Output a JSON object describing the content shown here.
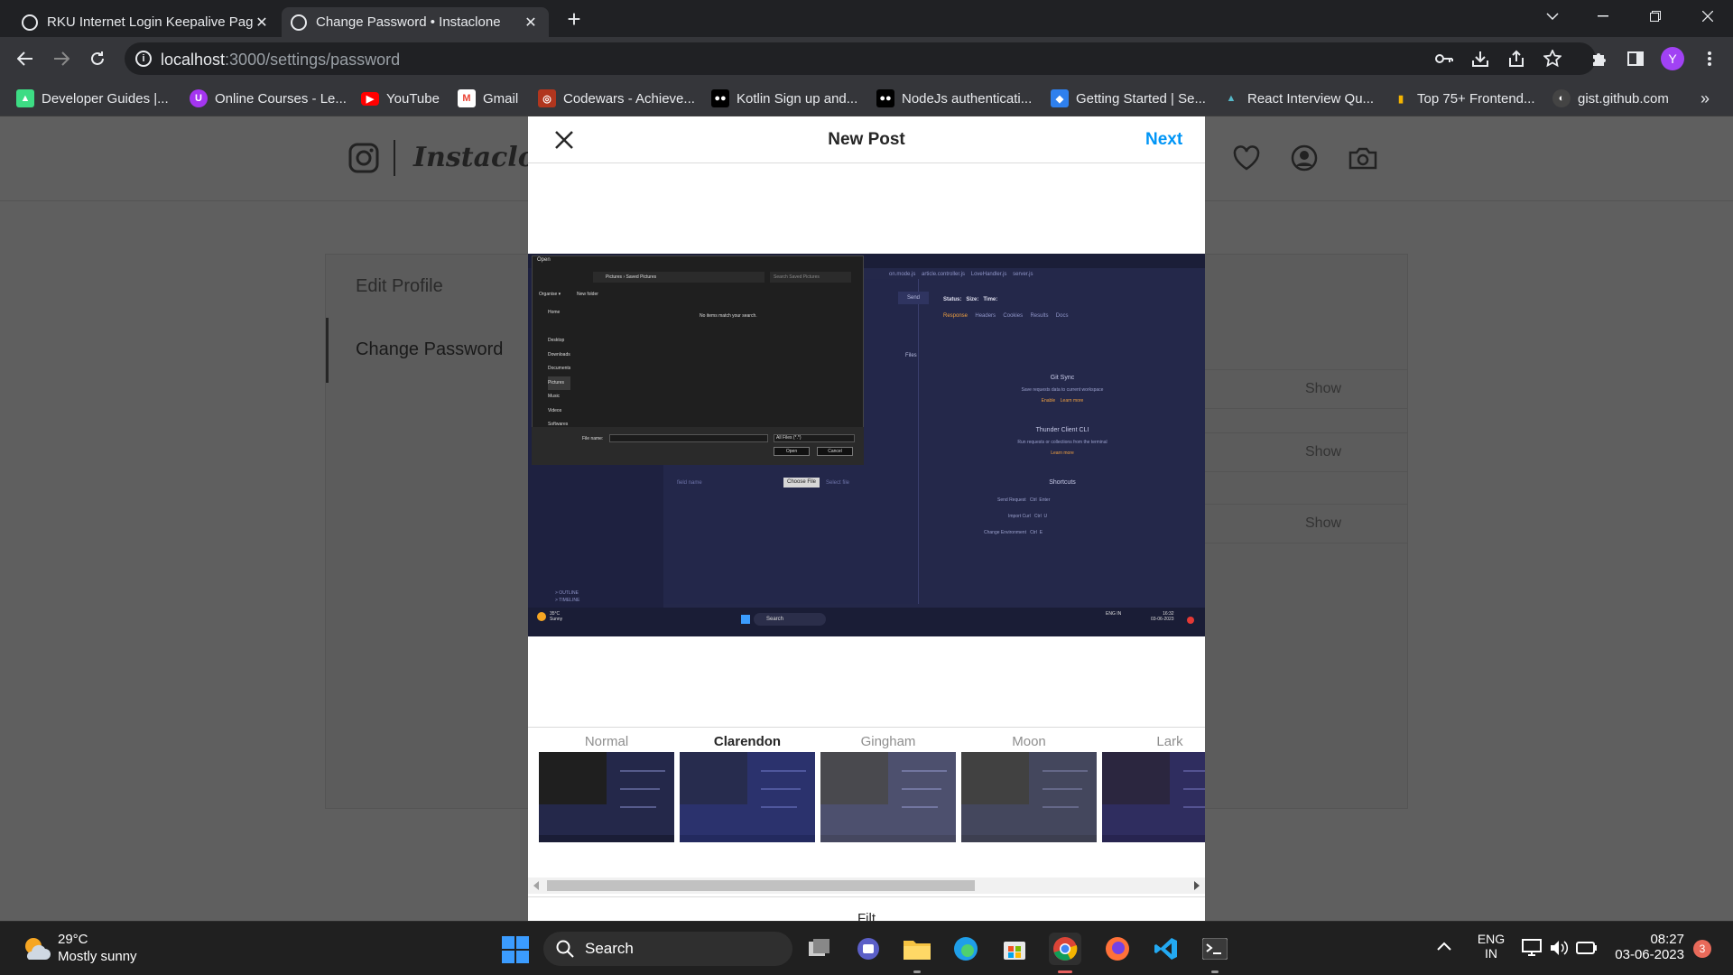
{
  "browser": {
    "tabs": [
      {
        "title": "RKU Internet Login Keepalive Pag",
        "active": false
      },
      {
        "title": "Change Password • Instaclone",
        "active": true
      }
    ],
    "new_tab_label": "+",
    "url_host": "localhost",
    "url_path": ":3000/settings/password",
    "profile_initial": "Y",
    "bookmarks": [
      {
        "label": "Developer Guides |...",
        "icon": "android-icon",
        "color": "#3ddc84"
      },
      {
        "label": "Online Courses - Le...",
        "icon": "udemy-icon",
        "color": "#a435f0"
      },
      {
        "label": "YouTube",
        "icon": "youtube-icon",
        "color": "#ff0000"
      },
      {
        "label": "Gmail",
        "icon": "gmail-icon",
        "color": "#ea4335"
      },
      {
        "label": "Codewars - Achieve...",
        "icon": "codewars-icon",
        "color": "#b1361e"
      },
      {
        "label": "Kotlin Sign up and...",
        "icon": "medium-icon",
        "color": "#000000"
      },
      {
        "label": "NodeJs authenticati...",
        "icon": "medium-icon",
        "color": "#000000"
      },
      {
        "label": "Getting Started | Se...",
        "icon": "sequelize-icon",
        "color": "#2f80ed"
      },
      {
        "label": "React Interview Qu...",
        "icon": "mountain-icon",
        "color": "#56b8c9"
      },
      {
        "label": "Top 75+ Frontend...",
        "icon": "bar-icon",
        "color": "#f4b400"
      },
      {
        "label": "gist.github.com",
        "icon": "github-icon",
        "color": "#444444"
      }
    ],
    "bookmarks_overflow": "»"
  },
  "app": {
    "logo_text": "Instaclon",
    "settings_menu": [
      {
        "label": "Edit Profile",
        "active": false
      },
      {
        "label": "Change Password",
        "active": true
      }
    ],
    "show_buttons": [
      "Show",
      "Show",
      "Show"
    ]
  },
  "modal": {
    "title": "New Post",
    "next_label": "Next",
    "filters": [
      {
        "name": "Normal",
        "selected": false,
        "tint": "rgba(0,0,0,0)"
      },
      {
        "name": "Clarendon",
        "selected": true,
        "tint": "rgba(60,80,200,0.28)"
      },
      {
        "name": "Gingham",
        "selected": false,
        "tint": "rgba(200,200,220,0.25)"
      },
      {
        "name": "Moon",
        "selected": false,
        "tint": "rgba(128,128,128,0.35)"
      },
      {
        "name": "Lark",
        "selected": false,
        "tint": "rgba(80,60,160,0.25)"
      }
    ],
    "bottom_label": "Filt",
    "preview": {
      "dialog_title": "Open",
      "breadcrumb": "Pictures › Saved Pictures",
      "search_placeholder": "Search Saved Pictures",
      "organise": "Organise ▾",
      "new_folder": "New folder",
      "empty_message": "No items match your search.",
      "sidebar": [
        "Home",
        "Desktop",
        "Downloads",
        "Documents",
        "Pictures",
        "Music",
        "Videos",
        "Softwares"
      ],
      "file_name_label": "File name:",
      "file_type": "All Files (*.*)",
      "open_btn": "Open",
      "cancel_btn": "Cancel",
      "editor_tabs": [
        "on.mode.js",
        "article.controller.js",
        "LoveHandler.js",
        "server.js"
      ],
      "send": "Send",
      "status_line": "Status:   Size:   Time:",
      "resp_tabs": [
        "Response",
        "Headers",
        "Cookies",
        "Results",
        "Docs"
      ],
      "files_label": "Files",
      "gitsync_title": "Git Sync",
      "gitsync_desc": "Save requests data to current workspace",
      "gitsync_links": "Enable    Learn more",
      "thunder_title": "Thunder Client CLI",
      "thunder_desc": "Run requests or collections from the terminal",
      "thunder_link": "Learn more",
      "shortcuts_title": "Shortcuts",
      "shortcuts": [
        {
          "name": "Send Request",
          "keys": "Ctrl  Enter"
        },
        {
          "name": "Import Curl",
          "keys": "Ctrl  U"
        },
        {
          "name": "Change Environment",
          "keys": "Ctrl  E"
        }
      ],
      "field_name": "field name",
      "choose_file": "Choose File",
      "select_file": "Select file",
      "outline": "> OUTLINE",
      "timeline": "> TIMELINE",
      "weather_temp": "35°C",
      "weather_desc": "Sunny",
      "search_label": "Search",
      "lang": "ENG IN",
      "time": "16:32",
      "date": "03-06-2023"
    }
  },
  "taskbar": {
    "weather_temp": "29°C",
    "weather_desc": "Mostly sunny",
    "search_label": "Search",
    "lang_top": "ENG",
    "lang_bottom": "IN",
    "time": "08:27",
    "date": "03-06-2023",
    "notification_count": "3"
  }
}
